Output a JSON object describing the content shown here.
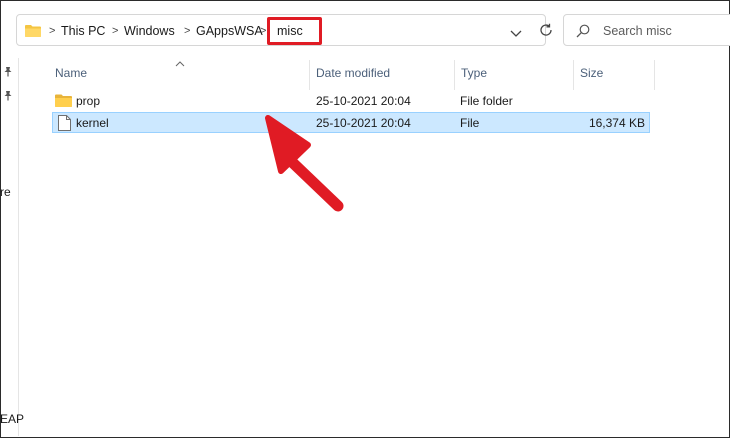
{
  "address_bar": {
    "breadcrumbs": [
      "This PC",
      "Windows",
      "GAppsWSA",
      "misc"
    ],
    "separator": ">"
  },
  "search": {
    "placeholder": "Search misc"
  },
  "nav_pane": {
    "partial_labels": [
      "re",
      "EAP"
    ]
  },
  "columns": {
    "name": "Name",
    "date_modified": "Date modified",
    "type": "Type",
    "size": "Size"
  },
  "files": [
    {
      "name": "prop",
      "date": "25-10-2021 20:04",
      "type": "File folder",
      "size": "",
      "icon": "folder-icon",
      "selected": false
    },
    {
      "name": "kernel",
      "date": "25-10-2021 20:04",
      "type": "File",
      "size": "16,374 KB",
      "icon": "file-icon",
      "selected": true
    }
  ],
  "colors": {
    "highlight": "#e01b24",
    "selection": "#cce8ff",
    "folder": "#f4c542"
  }
}
